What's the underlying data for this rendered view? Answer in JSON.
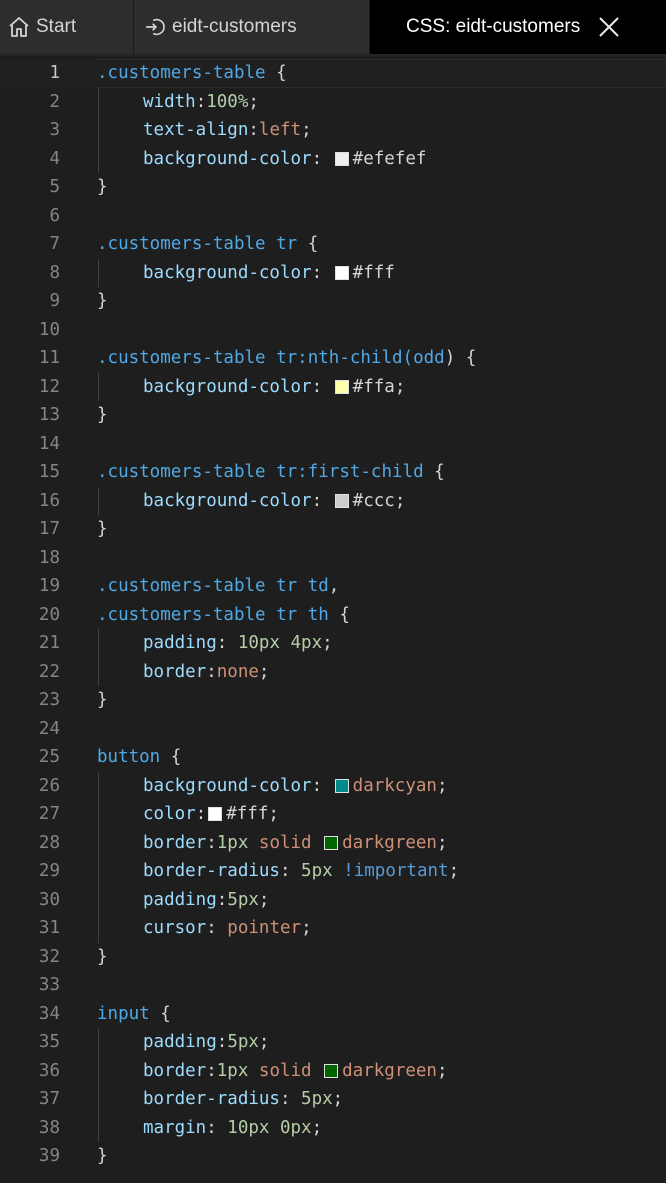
{
  "tabs": [
    {
      "label": "Start",
      "icon": "home-icon",
      "active": false
    },
    {
      "label": "eidt-customers",
      "icon": "enter-icon",
      "active": false
    },
    {
      "label": "CSS: eidt-customers",
      "icon": "close-icon",
      "active": true
    }
  ],
  "editor": {
    "current_line": 1,
    "lines": [
      {
        "n": "1",
        "indent": false,
        "parts": [
          {
            "t": "sel",
            "v": ".customers-table"
          },
          {
            "t": "punc",
            "v": " {"
          }
        ]
      },
      {
        "n": "2",
        "indent": true,
        "parts": [
          {
            "t": "prop",
            "v": "width"
          },
          {
            "t": "punc",
            "v": ":"
          },
          {
            "t": "num",
            "v": "100%"
          },
          {
            "t": "punc",
            "v": ";"
          }
        ]
      },
      {
        "n": "3",
        "indent": true,
        "parts": [
          {
            "t": "prop",
            "v": "text-align"
          },
          {
            "t": "punc",
            "v": ":"
          },
          {
            "t": "val",
            "v": "left"
          },
          {
            "t": "punc",
            "v": ";"
          }
        ]
      },
      {
        "n": "4",
        "indent": true,
        "parts": [
          {
            "t": "prop",
            "v": "background-color"
          },
          {
            "t": "punc",
            "v": ": "
          },
          {
            "t": "swatch",
            "c": "#efefef"
          },
          {
            "t": "hex",
            "v": "#efefef"
          }
        ]
      },
      {
        "n": "5",
        "indent": false,
        "parts": [
          {
            "t": "punc",
            "v": "}"
          }
        ]
      },
      {
        "n": "6",
        "indent": false,
        "parts": []
      },
      {
        "n": "7",
        "indent": false,
        "parts": [
          {
            "t": "sel",
            "v": ".customers-table tr"
          },
          {
            "t": "punc",
            "v": " {"
          }
        ]
      },
      {
        "n": "8",
        "indent": true,
        "parts": [
          {
            "t": "prop",
            "v": "background-color"
          },
          {
            "t": "punc",
            "v": ": "
          },
          {
            "t": "swatch",
            "c": "#ffffff"
          },
          {
            "t": "hex",
            "v": "#fff"
          }
        ]
      },
      {
        "n": "9",
        "indent": false,
        "parts": [
          {
            "t": "punc",
            "v": "}"
          }
        ]
      },
      {
        "n": "10",
        "indent": false,
        "parts": []
      },
      {
        "n": "11",
        "indent": false,
        "parts": [
          {
            "t": "sel",
            "v": ".customers-table tr:nth-child("
          },
          {
            "t": "sel",
            "v": "odd"
          },
          {
            "t": "punc",
            "v": ")"
          },
          {
            "t": "punc",
            "v": " {"
          }
        ]
      },
      {
        "n": "12",
        "indent": true,
        "parts": [
          {
            "t": "prop",
            "v": "background-color"
          },
          {
            "t": "punc",
            "v": ": "
          },
          {
            "t": "swatch",
            "c": "#ffffaa"
          },
          {
            "t": "hex",
            "v": "#ffa"
          },
          {
            "t": "punc",
            "v": ";"
          }
        ]
      },
      {
        "n": "13",
        "indent": false,
        "parts": [
          {
            "t": "punc",
            "v": "}"
          }
        ]
      },
      {
        "n": "14",
        "indent": false,
        "parts": []
      },
      {
        "n": "15",
        "indent": false,
        "parts": [
          {
            "t": "sel",
            "v": ".customers-table tr:first-child"
          },
          {
            "t": "punc",
            "v": " {"
          }
        ]
      },
      {
        "n": "16",
        "indent": true,
        "parts": [
          {
            "t": "prop",
            "v": "background-color"
          },
          {
            "t": "punc",
            "v": ": "
          },
          {
            "t": "swatch",
            "c": "#cccccc"
          },
          {
            "t": "hex",
            "v": "#ccc"
          },
          {
            "t": "punc",
            "v": ";"
          }
        ]
      },
      {
        "n": "17",
        "indent": false,
        "parts": [
          {
            "t": "punc",
            "v": "}"
          }
        ]
      },
      {
        "n": "18",
        "indent": false,
        "parts": []
      },
      {
        "n": "19",
        "indent": false,
        "parts": [
          {
            "t": "sel",
            "v": ".customers-table tr td"
          },
          {
            "t": "punc",
            "v": ","
          }
        ]
      },
      {
        "n": "20",
        "indent": false,
        "parts": [
          {
            "t": "sel",
            "v": ".customers-table tr th"
          },
          {
            "t": "punc",
            "v": " {"
          }
        ]
      },
      {
        "n": "21",
        "indent": true,
        "parts": [
          {
            "t": "prop",
            "v": "padding"
          },
          {
            "t": "punc",
            "v": ": "
          },
          {
            "t": "num",
            "v": "10px 4px"
          },
          {
            "t": "punc",
            "v": ";"
          }
        ]
      },
      {
        "n": "22",
        "indent": true,
        "parts": [
          {
            "t": "prop",
            "v": "border"
          },
          {
            "t": "punc",
            "v": ":"
          },
          {
            "t": "val",
            "v": "none"
          },
          {
            "t": "punc",
            "v": ";"
          }
        ]
      },
      {
        "n": "23",
        "indent": false,
        "parts": [
          {
            "t": "punc",
            "v": "}"
          }
        ]
      },
      {
        "n": "24",
        "indent": false,
        "parts": []
      },
      {
        "n": "25",
        "indent": false,
        "parts": [
          {
            "t": "sel",
            "v": "button"
          },
          {
            "t": "punc",
            "v": " {"
          }
        ]
      },
      {
        "n": "26",
        "indent": true,
        "parts": [
          {
            "t": "prop",
            "v": "background-color"
          },
          {
            "t": "punc",
            "v": ": "
          },
          {
            "t": "swatch",
            "c": "#008b8b"
          },
          {
            "t": "val",
            "v": "darkcyan"
          },
          {
            "t": "punc",
            "v": ";"
          }
        ]
      },
      {
        "n": "27",
        "indent": true,
        "parts": [
          {
            "t": "prop",
            "v": "color"
          },
          {
            "t": "punc",
            "v": ":"
          },
          {
            "t": "swatch",
            "c": "#ffffff"
          },
          {
            "t": "hex",
            "v": "#fff"
          },
          {
            "t": "punc",
            "v": ";"
          }
        ]
      },
      {
        "n": "28",
        "indent": true,
        "parts": [
          {
            "t": "prop",
            "v": "border"
          },
          {
            "t": "punc",
            "v": ":"
          },
          {
            "t": "num",
            "v": "1px"
          },
          {
            "t": "val",
            "v": " solid "
          },
          {
            "t": "swatch",
            "c": "#006400"
          },
          {
            "t": "val",
            "v": "darkgreen"
          },
          {
            "t": "punc",
            "v": ";"
          }
        ]
      },
      {
        "n": "29",
        "indent": true,
        "parts": [
          {
            "t": "prop",
            "v": "border-radius"
          },
          {
            "t": "punc",
            "v": ": "
          },
          {
            "t": "num",
            "v": "5px"
          },
          {
            "t": "imp",
            "v": " !important"
          },
          {
            "t": "punc",
            "v": ";"
          }
        ]
      },
      {
        "n": "30",
        "indent": true,
        "parts": [
          {
            "t": "prop",
            "v": "padding"
          },
          {
            "t": "punc",
            "v": ":"
          },
          {
            "t": "num",
            "v": "5px"
          },
          {
            "t": "punc",
            "v": ";"
          }
        ]
      },
      {
        "n": "31",
        "indent": true,
        "parts": [
          {
            "t": "prop",
            "v": "cursor"
          },
          {
            "t": "punc",
            "v": ": "
          },
          {
            "t": "val",
            "v": "pointer"
          },
          {
            "t": "punc",
            "v": ";"
          }
        ]
      },
      {
        "n": "32",
        "indent": false,
        "parts": [
          {
            "t": "punc",
            "v": "}"
          }
        ]
      },
      {
        "n": "33",
        "indent": false,
        "parts": []
      },
      {
        "n": "34",
        "indent": false,
        "parts": [
          {
            "t": "sel",
            "v": "input"
          },
          {
            "t": "punc",
            "v": " {"
          }
        ]
      },
      {
        "n": "35",
        "indent": true,
        "parts": [
          {
            "t": "prop",
            "v": "padding"
          },
          {
            "t": "punc",
            "v": ":"
          },
          {
            "t": "num",
            "v": "5px"
          },
          {
            "t": "punc",
            "v": ";"
          }
        ]
      },
      {
        "n": "36",
        "indent": true,
        "parts": [
          {
            "t": "prop",
            "v": "border"
          },
          {
            "t": "punc",
            "v": ":"
          },
          {
            "t": "num",
            "v": "1px"
          },
          {
            "t": "val",
            "v": " solid "
          },
          {
            "t": "swatch",
            "c": "#006400"
          },
          {
            "t": "val",
            "v": "darkgreen"
          },
          {
            "t": "punc",
            "v": ";"
          }
        ]
      },
      {
        "n": "37",
        "indent": true,
        "parts": [
          {
            "t": "prop",
            "v": "border-radius"
          },
          {
            "t": "punc",
            "v": ": "
          },
          {
            "t": "num",
            "v": "5px"
          },
          {
            "t": "punc",
            "v": ";"
          }
        ]
      },
      {
        "n": "38",
        "indent": true,
        "parts": [
          {
            "t": "prop",
            "v": "margin"
          },
          {
            "t": "punc",
            "v": ": "
          },
          {
            "t": "num",
            "v": "10px 0px"
          },
          {
            "t": "punc",
            "v": ";"
          }
        ]
      },
      {
        "n": "39",
        "indent": false,
        "parts": [
          {
            "t": "punc",
            "v": "}"
          }
        ]
      }
    ]
  }
}
